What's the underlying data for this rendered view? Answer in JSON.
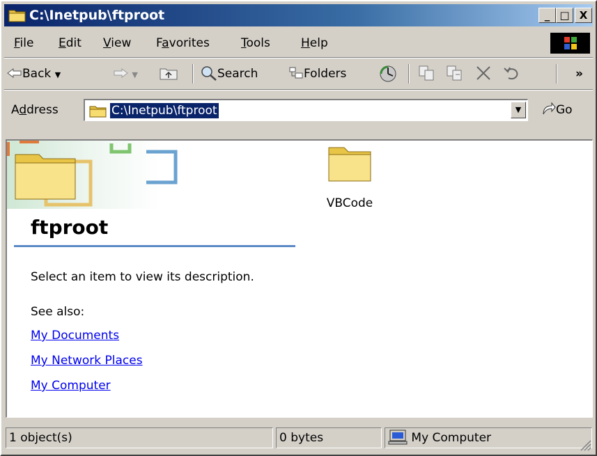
{
  "window": {
    "title": "C:\\Inetpub\\ftproot"
  },
  "title_buttons": {
    "minimize": "_",
    "maximize": "□",
    "close": "X"
  },
  "menu": [
    {
      "label": "File",
      "key": "F",
      "rest": "ile"
    },
    {
      "label": "Edit",
      "key": "E",
      "rest": "dit"
    },
    {
      "label": "View",
      "key": "V",
      "rest": "iew"
    },
    {
      "label": "Favorites",
      "key": "a",
      "pre": "F",
      "rest": "vorites"
    },
    {
      "label": "Tools",
      "key": "T",
      "rest": "ools"
    },
    {
      "label": "Help",
      "key": "H",
      "rest": "elp"
    }
  ],
  "toolbar": {
    "back": "Back",
    "search": "Search",
    "folders": "Folders",
    "chevron": "»"
  },
  "address": {
    "label_pre": "A",
    "label_key": "d",
    "label_rest": "dress",
    "value": "C:\\Inetpub\\ftproot",
    "go": "Go"
  },
  "panel": {
    "folder_name": "ftproot",
    "description": "Select an item to view its description.",
    "see_also": "See also:",
    "links": [
      "My Documents",
      "My Network Places",
      "My Computer"
    ]
  },
  "items": [
    {
      "name": "VBCode",
      "icon": "folder-icon"
    }
  ],
  "status": {
    "objects": "1 object(s)",
    "size": "0 bytes",
    "zone": "My Computer"
  },
  "colors": {
    "titlebar_start": "#0a246a",
    "titlebar_end": "#a6caf0",
    "chrome": "#d4d0c8",
    "link": "#0000ee",
    "accent_line": "#5b8ac6"
  }
}
